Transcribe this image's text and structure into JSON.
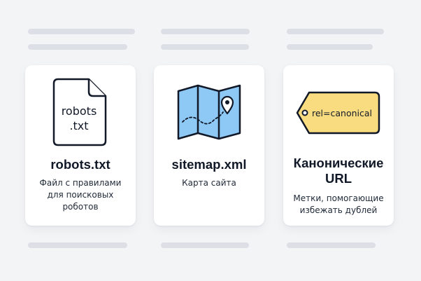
{
  "cards": [
    {
      "icon": "document-file-icon",
      "icon_text_line1": "robots",
      "icon_text_line2": ".txt",
      "title": "robots.txt",
      "desc_line1": "Файл с правилами",
      "desc_line2": "для поисковых",
      "desc_line3": "роботов"
    },
    {
      "icon": "folded-map-pin-icon",
      "title": "sitemap.xml",
      "desc_line1": "Карта сайта"
    },
    {
      "icon": "tag-label-icon",
      "tag_text": "rel=canonical",
      "title_line1": "Канонические",
      "title_line2": "URL",
      "desc_line1": "Метки, помогающие",
      "desc_line2": "избежать дублей"
    }
  ],
  "colors": {
    "background": "#f3f4f6",
    "card": "#ffffff",
    "map_fill": "#8ec9f5",
    "tag_fill": "#f9dc7f",
    "outline": "#111827",
    "skeleton": "#dcdfe5"
  }
}
